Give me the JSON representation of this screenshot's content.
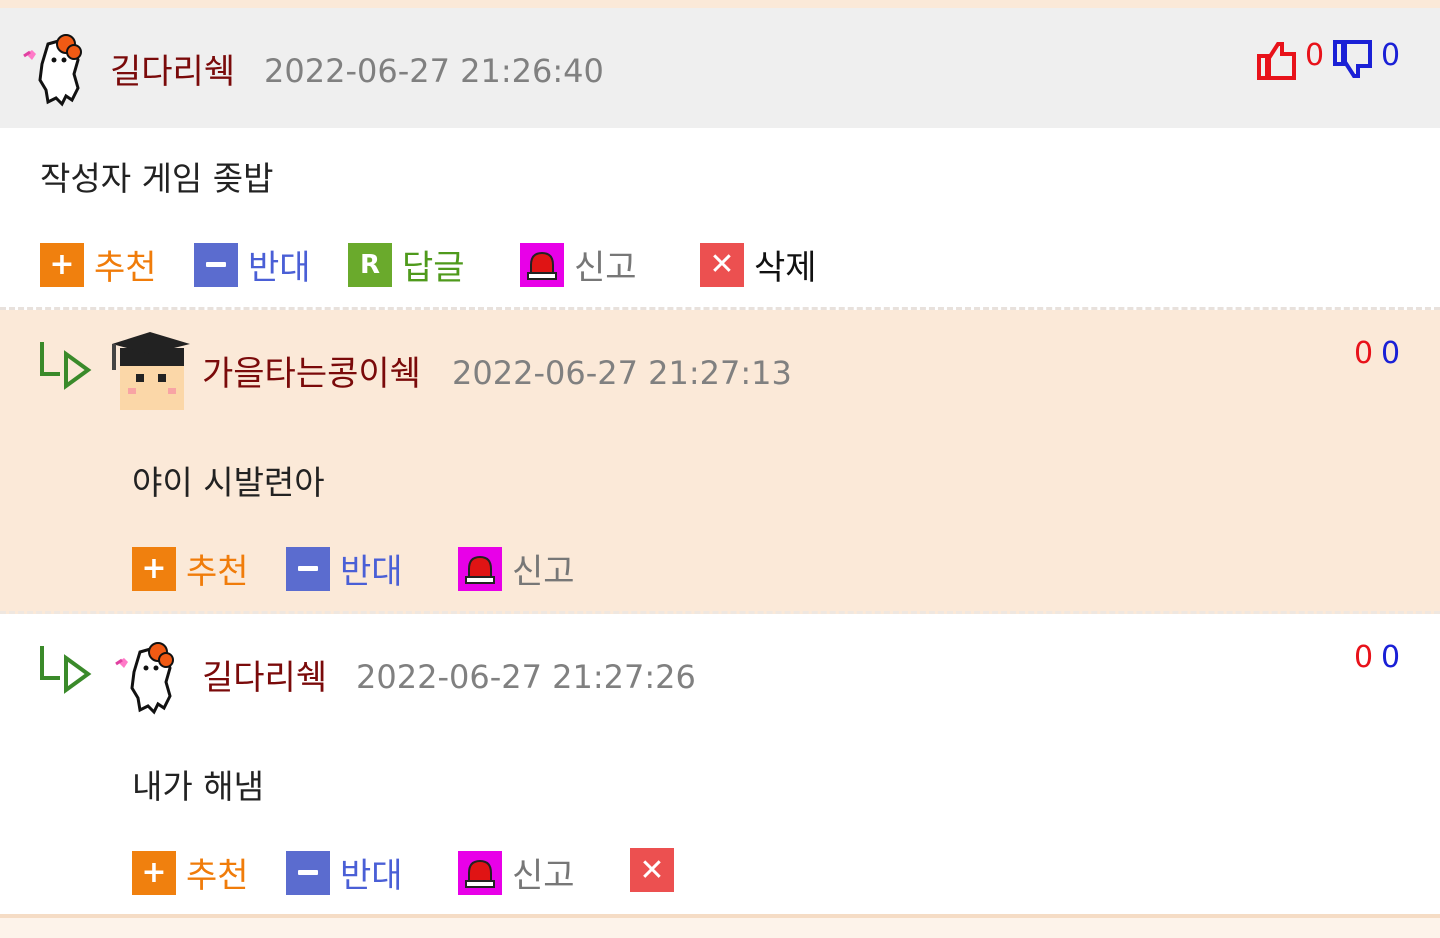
{
  "colors": {
    "nick": "#7a0a0a",
    "date": "#808080",
    "recommend": "#f07c0a",
    "oppose": "#4a5fd6",
    "reply": "#4f9a1c",
    "report_icon": "#e800e8",
    "delete_icon": "#ec5050",
    "up_vote": "#e8121a",
    "down_vote": "#1a20d6"
  },
  "comments": [
    {
      "nick": "길다리쉑",
      "date": "2022-06-27 21:26:40",
      "avatar": "hamster-avatar-icon",
      "content": "작성자 게임 좆밥",
      "up": "0",
      "down": "0",
      "actions": {
        "recommend": "추천",
        "oppose": "반대",
        "reply": "답글",
        "report": "신고",
        "delete": "삭제"
      }
    },
    {
      "nick": "가을타는콩이쉑",
      "date": "2022-06-27 21:27:13",
      "avatar": "graduate-avatar-icon",
      "content": "야이 시발련아",
      "up": "0",
      "down": "0",
      "actions": {
        "recommend": "추천",
        "oppose": "반대",
        "report": "신고"
      }
    },
    {
      "nick": "길다리쉑",
      "date": "2022-06-27 21:27:26",
      "avatar": "hamster-avatar-icon",
      "content": "내가 해냄",
      "up": "0",
      "down": "0",
      "actions": {
        "recommend": "추천",
        "oppose": "반대",
        "report": "신고"
      }
    }
  ]
}
